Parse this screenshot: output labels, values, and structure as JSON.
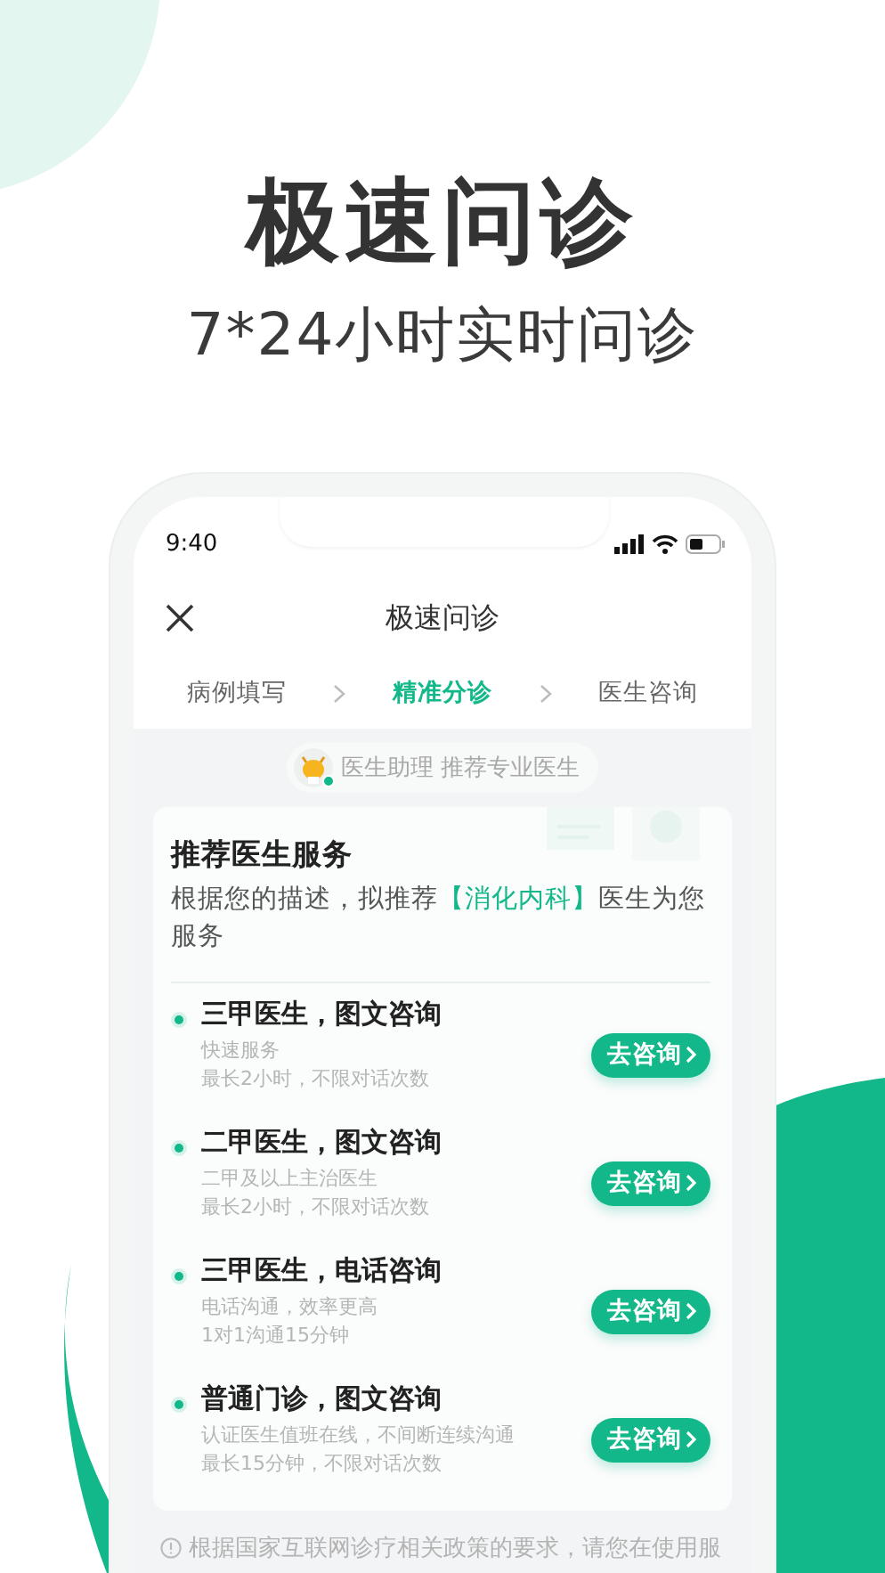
{
  "promo": {
    "headline": "极速问诊",
    "subtitle": "7*24小时实时问诊"
  },
  "status_bar": {
    "time": "9:40"
  },
  "nav": {
    "title": "极速问诊"
  },
  "steps": [
    {
      "label": "病例填写",
      "selected": false
    },
    {
      "label": "精准分诊",
      "selected": true
    },
    {
      "label": "医生咨询",
      "selected": false
    }
  ],
  "assistant": {
    "label": "医生助理 推荐专业医生",
    "online": true
  },
  "card": {
    "title": "推荐医生服务",
    "description": "根据您的描述，拟推荐**【消化内科】**医生为您服务",
    "services": [
      {
        "name": "三甲医生，图文咨询",
        "lines": [
          "快速服务",
          "最长2小时，不限对话次数"
        ],
        "button": "去咨询"
      },
      {
        "name": "二甲医生，图文咨询",
        "lines": [
          "二甲及以上主治医生",
          "最长2小时，不限对话次数"
        ],
        "button": "去咨询"
      },
      {
        "name": "三甲医生，电话咨询",
        "lines": [
          "电话沟通，效率更高",
          "1对1沟通15分钟"
        ],
        "button": "去咨询"
      },
      {
        "name": "普通门诊，图文咨询",
        "lines": [
          "认证医生值班在线，不间断连续沟通",
          "最长15分钟，不限对话次数"
        ],
        "button": "去咨询"
      }
    ]
  },
  "footer_note": "根据国家互联网诊疗相关政策的要求，请您在使用服"
}
